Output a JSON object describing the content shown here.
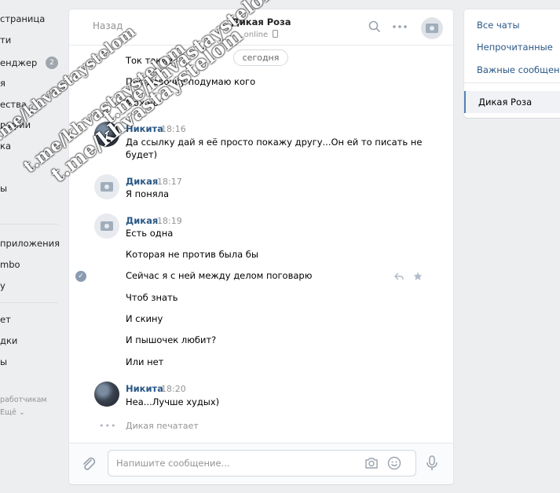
{
  "left_nav": {
    "items": [
      "страница",
      "ти",
      "енджер",
      "я",
      "ества",
      "рафии",
      "ка",
      "",
      "ы"
    ],
    "badge": "2",
    "apps": [
      "приложения",
      "mbo",
      "у"
    ],
    "more": [
      "ет",
      "дки",
      "ы"
    ],
    "footer": [
      "работчикам",
      "Ещё ⌄"
    ]
  },
  "header": {
    "back_label": "Назад",
    "peer_name": "Дикая Роза",
    "peer_status": "online"
  },
  "date_pill": "сегодня",
  "messages": {
    "m1": "Ток такие",
    "m2": "Про девочку подумаю кого",
    "m3": "Можно",
    "g1": {
      "author": "Никита",
      "time": "18:16",
      "line1": "Да ссылку дай я её просто покажу другу...Он ей то писать не",
      "line2": "будет)"
    },
    "g2": {
      "author": "Дикая",
      "time": "18:17",
      "text": "Я поняла"
    },
    "g3": {
      "author": "Дикая",
      "time": "18:19",
      "text": "Есть одна"
    },
    "m4": "Которая не против была бы",
    "m5": "Сейчас я с ней между делом поговарю",
    "m6": "Чтоб знать",
    "m7": "И скину",
    "m8": "И пышочек любит?",
    "m9": "Или нет",
    "g4": {
      "author": "Никита",
      "time": "18:20",
      "text": "Неа...Лучше худых)"
    },
    "typing": "Дикая печатает"
  },
  "composer": {
    "placeholder": "Напишите сообщение..."
  },
  "right_panel": {
    "all_chats": "Все чаты",
    "unread": "Непрочитанные",
    "important": "Важные сообщения",
    "active_chat": "Дикая Роза"
  },
  "watermark": {
    "text": "t.me/khvastaystelom"
  },
  "colors": {
    "link": "#2a5885",
    "accent": "#5181b8",
    "muted": "#939393",
    "background": "#edeef0"
  }
}
